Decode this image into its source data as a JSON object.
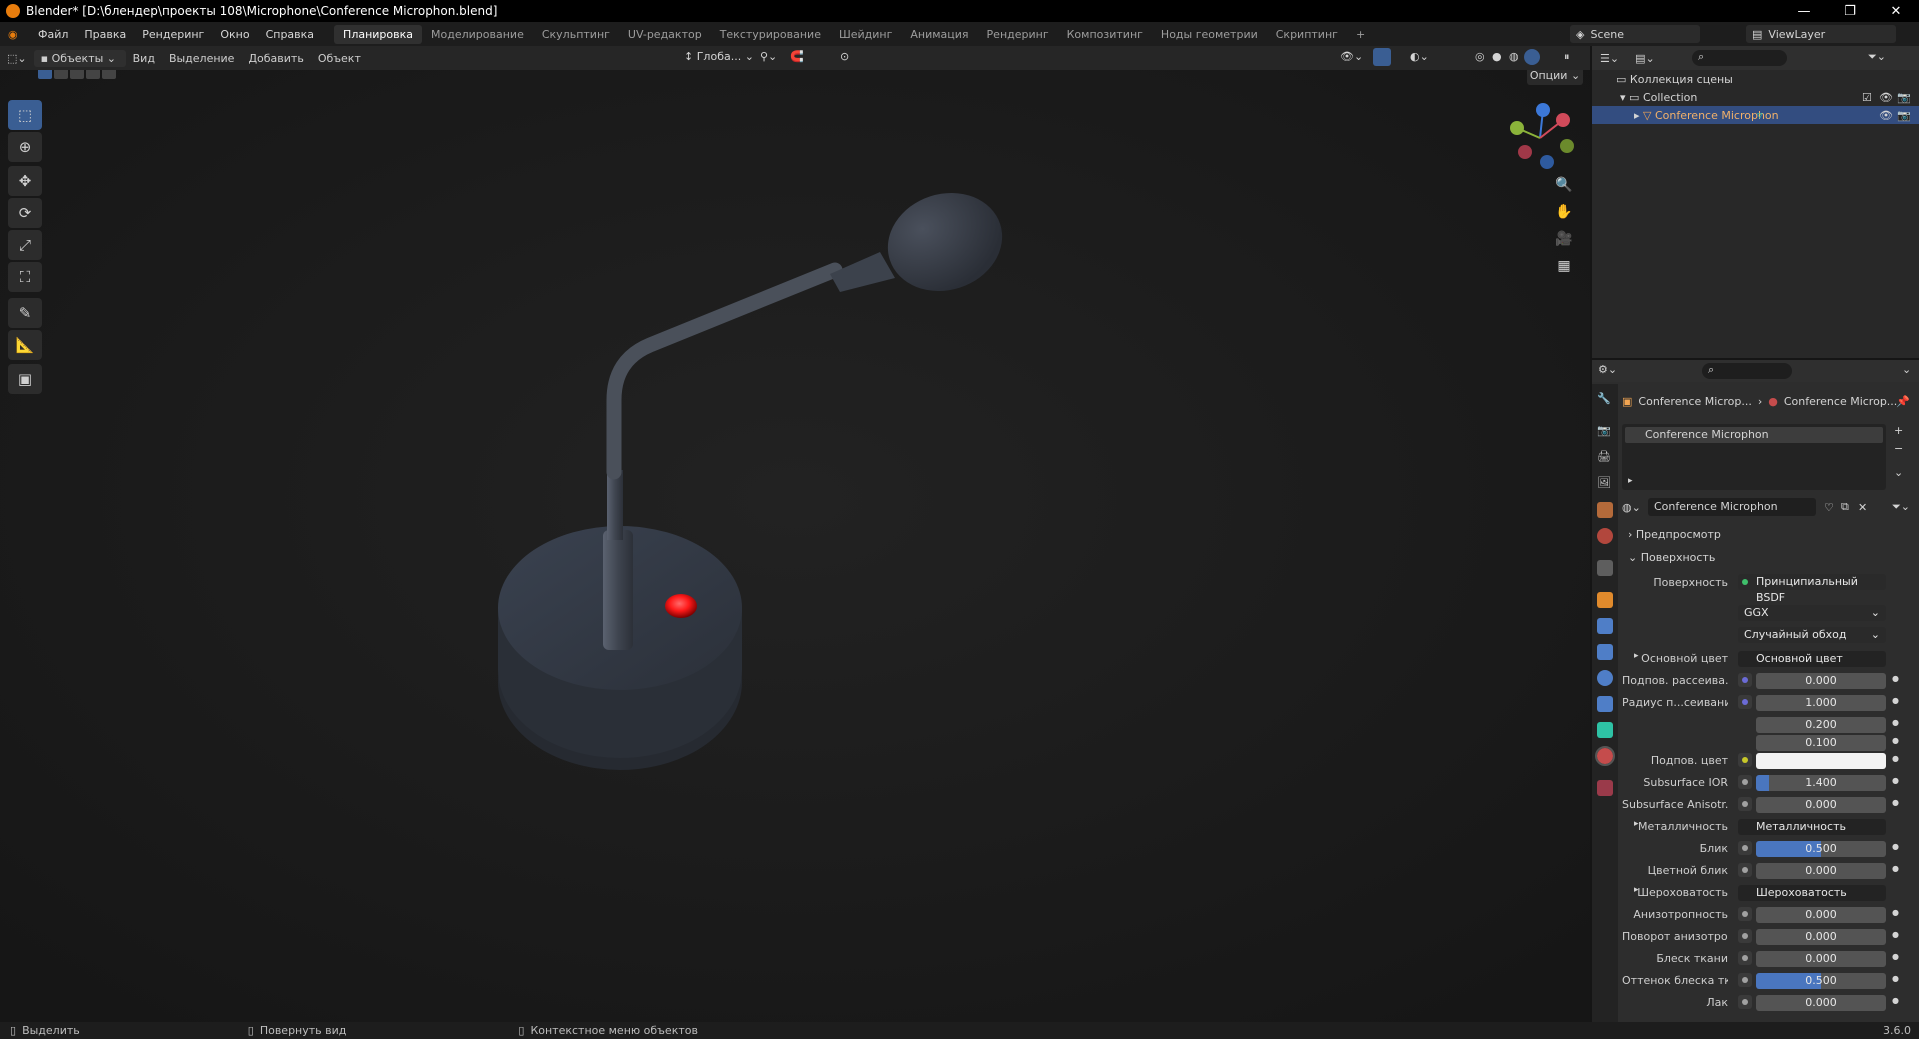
{
  "window": {
    "title": "Blender* [D:\\блендер\\проекты 108\\Microphone\\Conference Microphon.blend]"
  },
  "menu": {
    "items": [
      "Файл",
      "Правка",
      "Рендеринг",
      "Окно",
      "Справка"
    ],
    "workspaces": [
      "Планировка",
      "Моделирование",
      "Скульптинг",
      "UV-редактор",
      "Текстурирование",
      "Шейдинг",
      "Анимация",
      "Рендеринг",
      "Композитинг",
      "Ноды геометрии",
      "Скриптинг"
    ],
    "active_workspace": "Планировка",
    "scene": "Scene",
    "view_layer": "ViewLayer"
  },
  "viewport_header": {
    "mode": "Объекты",
    "menus": [
      "Вид",
      "Выделение",
      "Добавить",
      "Объект"
    ],
    "orientation": "Глоба...",
    "options": "Опции"
  },
  "outliner": {
    "root": "Коллекция сцены",
    "collection": "Collection",
    "object": "Conference Microphon"
  },
  "properties": {
    "breadcrumb_object": "Conference Microp...",
    "breadcrumb_material": "Conference Microp...",
    "slot": "Conference Microphon",
    "material_name": "Conference Microphon",
    "panel_preview": "Предпросмотр",
    "panel_surface": "Поверхность",
    "surface_label": "Поверхность",
    "surface_value": "Принципиальный BSDF",
    "distribution": "GGX",
    "subsurface_method": "Случайный обход",
    "rows": [
      {
        "label": "Основной цвет",
        "value": "Основной цвет",
        "kind": "socket",
        "dot": "#c7c729",
        "arrow": true
      },
      {
        "label": "Подпов. рассеива...",
        "value": "0.000",
        "kind": "num",
        "dot": "#6b6bd6"
      },
      {
        "label": "Радиус п...сеивания",
        "value": "1.000",
        "kind": "num",
        "dot": "#6b6bd6"
      },
      {
        "label": "",
        "value": "0.200",
        "kind": "num",
        "dot": ""
      },
      {
        "label": "",
        "value": "0.100",
        "kind": "num",
        "dot": ""
      },
      {
        "label": "Подпов. цвет",
        "value": "",
        "kind": "color",
        "dot": "#c7c729"
      },
      {
        "label": "Subsurface IOR",
        "value": "1.400",
        "kind": "num-partial",
        "dot": "#a1a1a1"
      },
      {
        "label": "Subsurface Anisotr...",
        "value": "0.000",
        "kind": "num",
        "dot": "#a1a1a1"
      },
      {
        "label": "Металличность",
        "value": "Металличность",
        "kind": "socket",
        "dot": "#a1a1a1",
        "arrow": true
      },
      {
        "label": "Блик",
        "value": "0.500",
        "kind": "num-blue",
        "dot": "#a1a1a1"
      },
      {
        "label": "Цветной блик",
        "value": "0.000",
        "kind": "num",
        "dot": "#a1a1a1"
      },
      {
        "label": "Шероховатость",
        "value": "Шероховатость",
        "kind": "socket",
        "dot": "#a1a1a1",
        "arrow": true
      },
      {
        "label": "Анизотропность",
        "value": "0.000",
        "kind": "num",
        "dot": "#a1a1a1"
      },
      {
        "label": "Поворот анизотро...",
        "value": "0.000",
        "kind": "num",
        "dot": "#a1a1a1"
      },
      {
        "label": "Блеск ткани",
        "value": "0.000",
        "kind": "num",
        "dot": "#a1a1a1"
      },
      {
        "label": "Оттенок блеска тк...",
        "value": "0.500",
        "kind": "num-blue",
        "dot": "#a1a1a1"
      },
      {
        "label": "Лак",
        "value": "0.000",
        "kind": "num",
        "dot": "#a1a1a1"
      }
    ]
  },
  "statusbar": {
    "select": "Выделить",
    "rotate": "Повернуть вид",
    "context": "Контекстное меню объектов",
    "version": "3.6.0"
  },
  "colors": {
    "accent": "#4a76bf",
    "selected_row": "#334d80",
    "button_led": "#ff1a1a",
    "header_bg": "#1d1d1d"
  }
}
